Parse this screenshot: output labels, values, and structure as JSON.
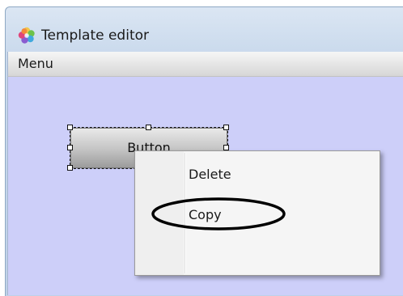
{
  "window": {
    "title": "Template editor",
    "icon": "app-flower-icon"
  },
  "menubar": {
    "items": [
      "Menu"
    ]
  },
  "canvas": {
    "element_label": "Button",
    "background_color": "#cdcff9"
  },
  "context_menu": {
    "items": [
      "Delete",
      "Copy"
    ],
    "highlighted_item": "Copy"
  }
}
